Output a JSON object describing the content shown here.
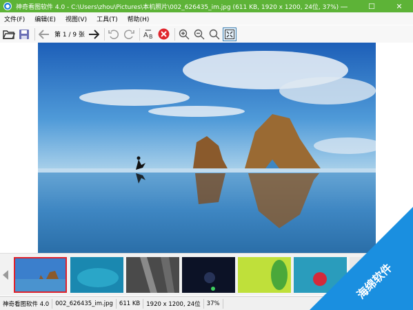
{
  "titlebar": {
    "title": "神奇看图软件 4.0 - C:\\Users\\zhou\\Pictures\\本机照片\\002_626435_im.jpg (611 KB, 1920 x 1200, 24位, 37%)",
    "minimize": "—",
    "maximize": "☐",
    "close": "✕"
  },
  "menu": {
    "items": [
      {
        "label": "文件(F)"
      },
      {
        "label": "编辑(E)"
      },
      {
        "label": "视图(V)"
      },
      {
        "label": "工具(T)"
      },
      {
        "label": "帮助(H)"
      }
    ]
  },
  "toolbar": {
    "page_label": "第 1 / 9 张"
  },
  "statusbar": {
    "app": "神奇看图软件 4.0",
    "filename": "002_626435_im.jpg",
    "size": "611 KB",
    "dims": "1920 x 1200, 24位",
    "zoom": "37%"
  },
  "watermark": {
    "text": "海绵软件"
  },
  "colors": {
    "titlebar": "#5db337",
    "selected_thumb": "#e0202a",
    "watermark": "#1a8fe0"
  }
}
